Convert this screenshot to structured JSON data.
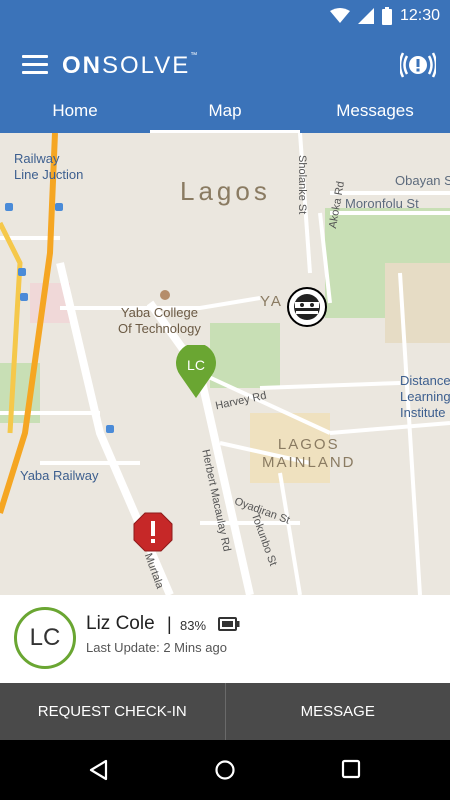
{
  "status_bar": {
    "time": "12:30"
  },
  "app": {
    "logo_bold": "ON",
    "logo_light": "SOLVE",
    "logo_mark": "™"
  },
  "tabs": [
    {
      "label": "Home",
      "active": false
    },
    {
      "label": "Map",
      "active": true
    },
    {
      "label": "Messages",
      "active": false
    }
  ],
  "map": {
    "labels": {
      "railway_junction": "Railway\nLine Juction",
      "lagos": "Lagos",
      "obayan": "Obayan St",
      "moronfolu": "Moronfolu St",
      "sholanke": "Sholanke St",
      "akoka": "Akoka Rd",
      "yaba_college": "Yaba College\nOf Technology",
      "yaba_short": "YA",
      "harvey": "Harvey Rd",
      "distance_learning": "Distance\nLearning\nInstitute",
      "lagos_mainland": "LAGOS\nMAINLAND",
      "yaba_railway": "Yaba Railway",
      "herbert": "Herbert Macaulay Rd",
      "oyadiran": "Oyadiran St",
      "tokunbo": "Tokunbo St",
      "murtala": "Murtala"
    },
    "marker_initials": "LC"
  },
  "person": {
    "initials": "LC",
    "name": "Liz Cole",
    "separator": "|",
    "battery": "83%",
    "last_update": "Last Update: 2 Mins ago"
  },
  "actions": {
    "request_checkin": "REQUEST CHECK-IN",
    "message": "MESSAGE"
  },
  "colors": {
    "primary": "#3b73b9",
    "marker_green": "#6aa632",
    "marker_red": "#c62828"
  }
}
